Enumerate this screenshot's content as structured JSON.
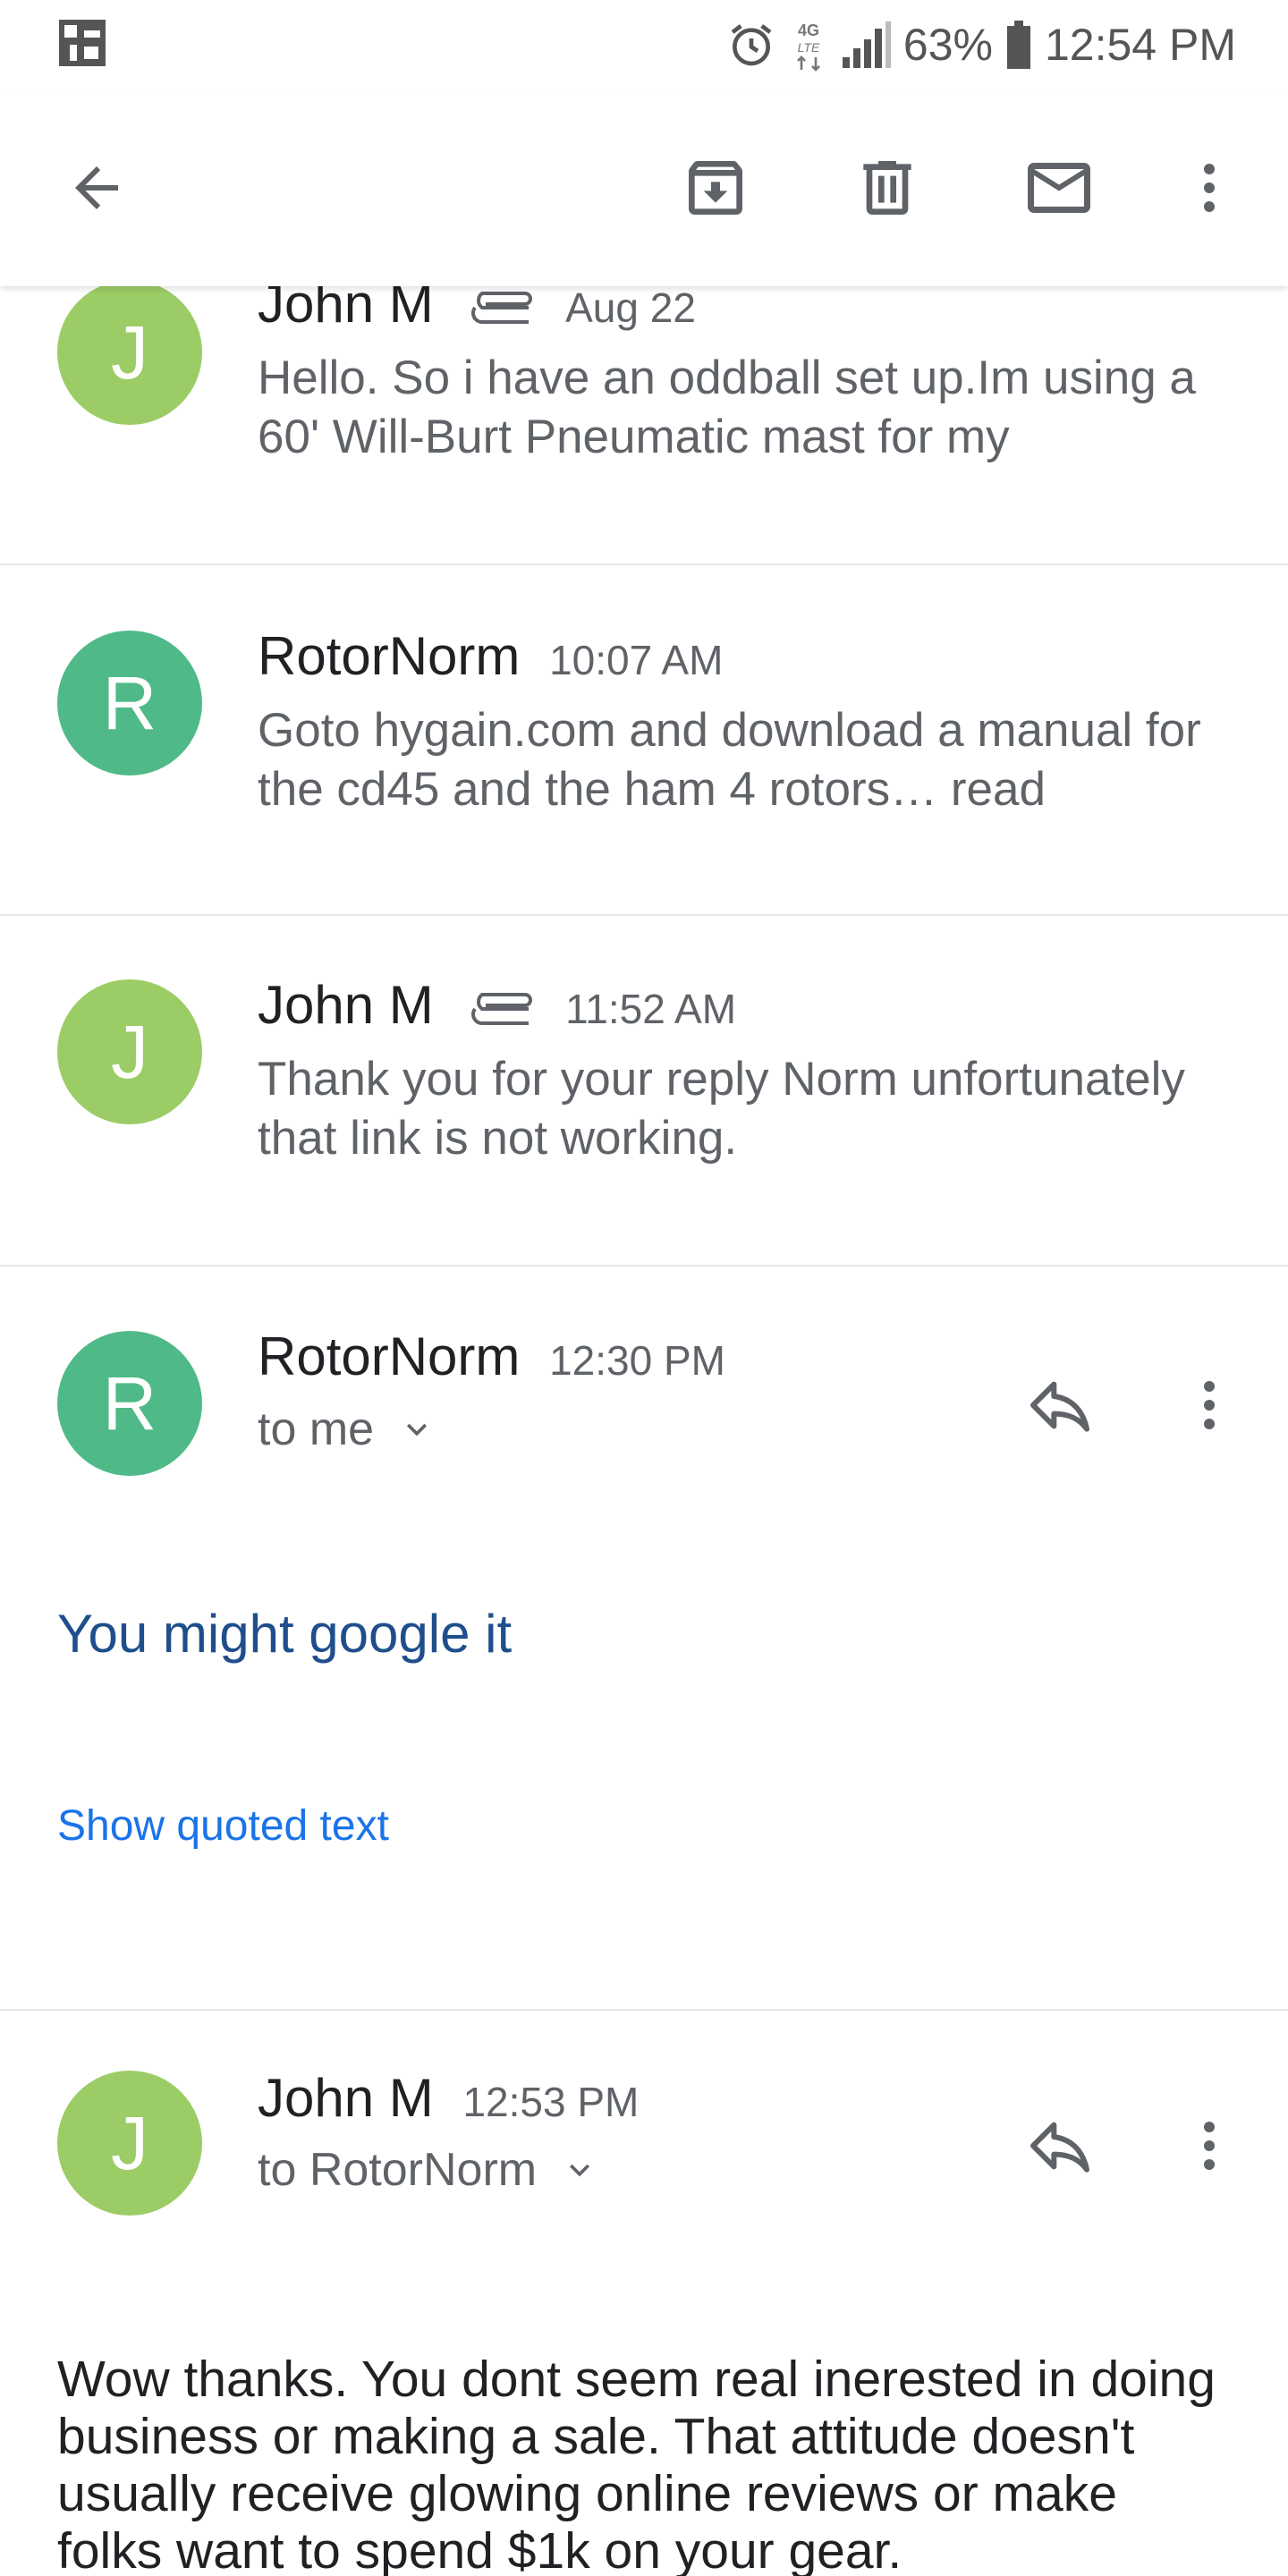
{
  "status_bar": {
    "battery": "63%",
    "time": "12:54 PM",
    "network": "4G LTE",
    "icons": [
      "app-logo-icon",
      "alarm-icon",
      "network-4g-lte-icon",
      "signal-bars-icon",
      "battery-icon"
    ]
  },
  "app_bar": {
    "icons": [
      "back-arrow-icon",
      "archive-icon",
      "delete-icon",
      "mark-unread-icon",
      "more-vert-icon"
    ]
  },
  "colors": {
    "avatar_j": "#9ccc65",
    "avatar_r": "#4fba87",
    "link_blue": "#1a73e8",
    "body_blue": "#1f4e8c"
  },
  "messages": [
    {
      "sender": "John M",
      "time": "Aug 22",
      "initial": "J",
      "has_attachment": true,
      "snippet": "Hello. So i have an oddball set up.Im using a 60' Will-Burt Pneumatic mast for my"
    },
    {
      "sender": "RotorNorm",
      "time": "10:07 AM",
      "initial": "R",
      "has_attachment": false,
      "snippet": "Goto hygain.com and download a manual for the cd45 and the ham 4 rotors… read"
    },
    {
      "sender": "John M",
      "time": "11:52 AM",
      "initial": "J",
      "has_attachment": true,
      "snippet": "Thank you for your reply Norm unfortunately that link is not working."
    },
    {
      "sender": "RotorNorm",
      "time": "12:30 PM",
      "initial": "R",
      "recipient": "to me",
      "body": "You might google it",
      "show_quoted": "Show quoted text"
    },
    {
      "sender": "John M",
      "time": "12:53 PM",
      "initial": "J",
      "recipient": "to RotorNorm",
      "body": "Wow thanks. You dont seem real inerested in doing business or making a sale. That attitude doesn't usually receive glowing online reviews or make folks want to spend $1k on your gear."
    }
  ]
}
